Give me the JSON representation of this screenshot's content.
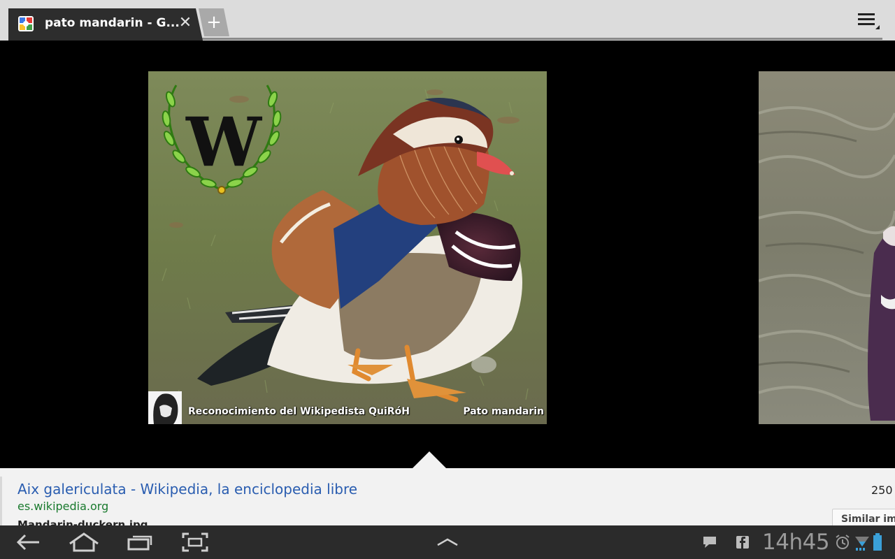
{
  "browser": {
    "tab_title": "pato mandarin - G...",
    "close_glyph": "✕",
    "new_tab_glyph": "+",
    "favicon": "google-favicon",
    "menu": "menu-icon"
  },
  "viewer": {
    "caption_left": "Reconocimiento del Wikipedista QuiRóH",
    "caption_right": "Pato mandarin",
    "logo_letter": "W"
  },
  "result": {
    "title": "Aix galericulata - Wikipedia, la enciclopedia libre",
    "url": "es.wikipedia.org",
    "snippet": "Mandarin-duckern.jpg",
    "size": "250",
    "similar_label": "Similar ima"
  },
  "system_bar": {
    "clock": "14h45",
    "icons": [
      "back-icon",
      "home-icon",
      "recent-apps-icon",
      "screenshot-icon",
      "chevron-up-icon",
      "chat-icon",
      "facebook-icon",
      "alarm-icon",
      "wifi-icon",
      "battery-icon"
    ]
  },
  "colors": {
    "link": "#2a5db0",
    "url": "#1a7a2e",
    "tab_bg": "#2d2d2d",
    "system_bar": "#2b2b2b"
  }
}
